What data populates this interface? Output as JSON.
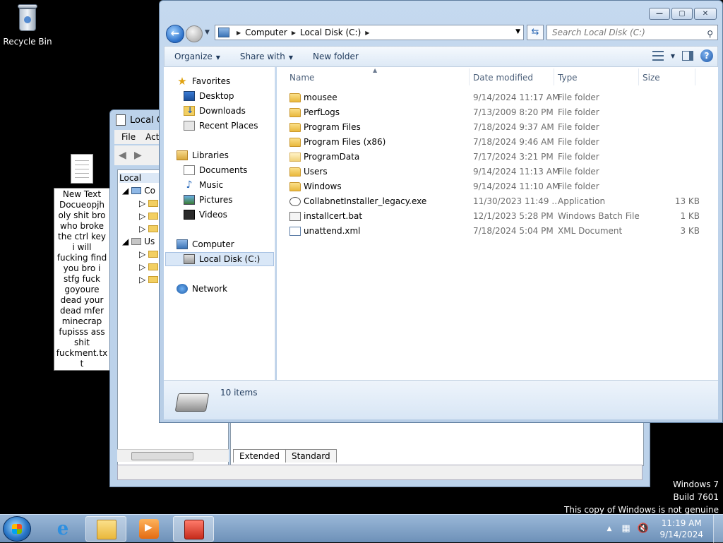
{
  "desktop": {
    "recycle_bin_label": "Recycle Bin",
    "text_file_label": "New Text Docueopjh oly shit bro who broke the ctrl key i will fucking find you bro i stfg fuck goyoure dead your dead mfer minecrap fupisss ass shit fuckment.txt",
    "watermark": {
      "line1": "Windows 7",
      "line2": "Build 7601",
      "line3": "This copy of Windows is not genuine"
    }
  },
  "bg_window": {
    "title": "Local G",
    "menu": [
      "File",
      "Act"
    ],
    "tree_root": "Local",
    "tree_items": [
      "Co",
      "Us"
    ],
    "tabs": [
      "Extended",
      "Standard"
    ]
  },
  "explorer": {
    "breadcrumb": [
      "Computer",
      "Local Disk (C:)"
    ],
    "search_placeholder": "Search Local Disk (C:)",
    "toolbar": {
      "organize": "Organize",
      "share_with": "Share with",
      "new_folder": "New folder"
    },
    "nav": {
      "favorites": "Favorites",
      "desktop": "Desktop",
      "downloads": "Downloads",
      "recent": "Recent Places",
      "libraries": "Libraries",
      "documents": "Documents",
      "music": "Music",
      "pictures": "Pictures",
      "videos": "Videos",
      "computer": "Computer",
      "local_disk": "Local Disk (C:)",
      "network": "Network"
    },
    "columns": {
      "name": "Name",
      "date": "Date modified",
      "type": "Type",
      "size": "Size"
    },
    "files": [
      {
        "name": "mousee",
        "date": "9/14/2024 11:17 AM",
        "type": "File folder",
        "size": "",
        "icon": "folder-icon"
      },
      {
        "name": "PerfLogs",
        "date": "7/13/2009 8:20 PM",
        "type": "File folder",
        "size": "",
        "icon": "folder-icon"
      },
      {
        "name": "Program Files",
        "date": "7/18/2024 9:37 AM",
        "type": "File folder",
        "size": "",
        "icon": "folder-icon"
      },
      {
        "name": "Program Files (x86)",
        "date": "7/18/2024 9:46 AM",
        "type": "File folder",
        "size": "",
        "icon": "folder-icon"
      },
      {
        "name": "ProgramData",
        "date": "7/17/2024 3:21 PM",
        "type": "File folder",
        "size": "",
        "icon": "folder-open-icon"
      },
      {
        "name": "Users",
        "date": "9/14/2024 11:13 AM",
        "type": "File folder",
        "size": "",
        "icon": "folder-icon"
      },
      {
        "name": "Windows",
        "date": "9/14/2024 11:10 AM",
        "type": "File folder",
        "size": "",
        "icon": "folder-icon"
      },
      {
        "name": "CollabnetInstaller_legacy.exe",
        "date": "11/30/2023 11:49 ...",
        "type": "Application",
        "size": "13 KB",
        "icon": "exe-icon"
      },
      {
        "name": "installcert.bat",
        "date": "12/1/2023 5:28 PM",
        "type": "Windows Batch File",
        "size": "1 KB",
        "icon": "bat-icon"
      },
      {
        "name": "unattend.xml",
        "date": "7/18/2024 5:04 PM",
        "type": "XML Document",
        "size": "3 KB",
        "icon": "xml-icon"
      }
    ],
    "item_count": "10 items"
  },
  "taskbar": {
    "clock_time": "11:19 AM",
    "clock_date": "9/14/2024"
  }
}
